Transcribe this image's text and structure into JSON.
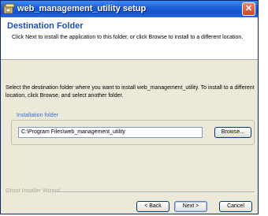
{
  "window": {
    "title": "web_management_utility setup",
    "close_label": "✕"
  },
  "header": {
    "title": "Destination Folder",
    "description": "Click Next to install the application to this folder, or click Browse to install to a different location."
  },
  "body": {
    "instructions": "Select the destination folder where you want to install web_management_utility. To install to a different location, click Browse, and select another folder."
  },
  "install_folder": {
    "legend": "Installation folder",
    "path": "C:\\Program Files\\web_management_utility",
    "browse_label": "Browse..."
  },
  "footer": {
    "brand": "Ghost Installer Wizard",
    "back_label": "< Back",
    "next_label": "Next >",
    "cancel_label": "Cancel"
  },
  "icons": {
    "app": "setup-app-icon",
    "close": "close-icon"
  },
  "colors": {
    "titlebar": "#1f5fd8",
    "header_title": "#1f50a8",
    "dialog_face": "#ece9d8"
  }
}
